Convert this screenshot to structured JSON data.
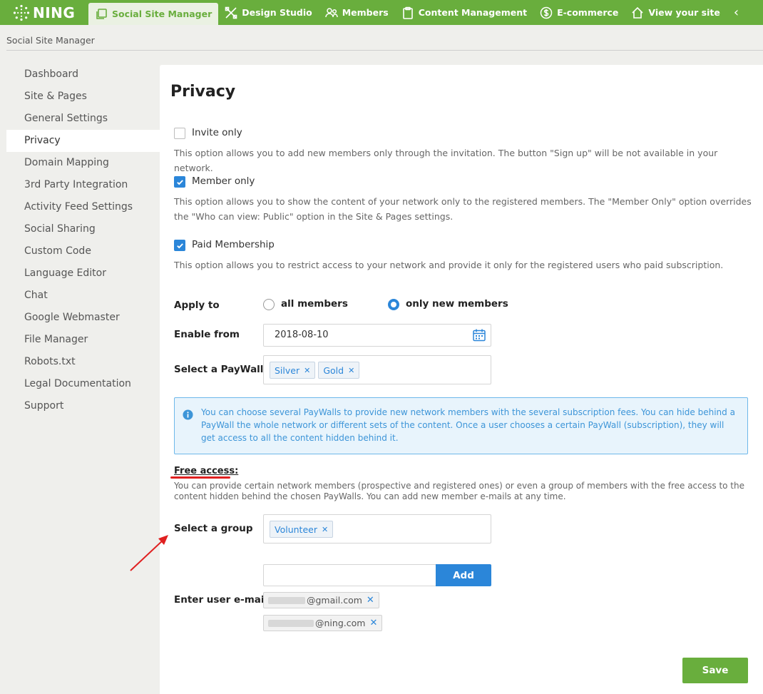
{
  "app": {
    "logo_text": "NING"
  },
  "topnav": {
    "tabs": [
      {
        "label": "Social Site Manager",
        "icon": "pages-icon"
      },
      {
        "label": "Design Studio",
        "icon": "design-tools-icon"
      },
      {
        "label": "Members",
        "icon": "members-icon"
      },
      {
        "label": "Content Management",
        "icon": "clipboard-icon"
      },
      {
        "label": "E-commerce",
        "icon": "dollar-icon"
      },
      {
        "label": "View your site",
        "icon": "home-icon"
      }
    ],
    "collapse_glyph": "‹"
  },
  "breadcrumb": "Social Site Manager",
  "sidebar": {
    "items": [
      {
        "label": "Dashboard"
      },
      {
        "label": "Site & Pages"
      },
      {
        "label": "General Settings"
      },
      {
        "label": "Privacy"
      },
      {
        "label": "Domain Mapping"
      },
      {
        "label": "3rd Party Integration"
      },
      {
        "label": "Activity Feed Settings"
      },
      {
        "label": "Social Sharing"
      },
      {
        "label": "Custom Code"
      },
      {
        "label": "Language Editor"
      },
      {
        "label": "Chat"
      },
      {
        "label": "Google Webmaster"
      },
      {
        "label": "File Manager"
      },
      {
        "label": "Robots.txt"
      },
      {
        "label": "Legal Documentation"
      },
      {
        "label": "Support"
      }
    ],
    "active_index": 3
  },
  "page": {
    "title": "Privacy",
    "options": [
      {
        "label": "Invite only",
        "checked": false,
        "description": "This option allows you to add new members only through the invitation. The button \"Sign up\" will be not available in your network."
      },
      {
        "label": "Member only",
        "checked": true,
        "description": "This option allows you to show the content of your network only to the registered members. The \"Member Only\" option overrides the \"Who can view: Public\" option in the Site & Pages settings."
      },
      {
        "label": "Paid Membership",
        "checked": true,
        "description": "This option allows you to restrict access to your network and provide it only for the registered users who paid subscription."
      }
    ],
    "apply_to": {
      "label": "Apply to",
      "options": [
        "all members",
        "only new members"
      ],
      "selected": "only new members"
    },
    "enable_from": {
      "label": "Enable from",
      "value": "2018-08-10"
    },
    "paywall": {
      "label": "Select a PayWall",
      "tags": [
        "Silver",
        "Gold"
      ]
    },
    "info_text": "You can choose several PayWalls to provide new network members with the several subscription fees. You can hide behind a PayWall the whole network or different sets of the content. Once a user chooses a certain PayWall (subscription), they will get access to all the content hidden behind it.",
    "free_access": {
      "title": "Free access:",
      "description": "You can provide certain network members (prospective and registered ones) or even a group of members with the free access to the content hidden behind the chosen PayWalls. You can add new member e-mails at any time."
    },
    "group": {
      "label": "Select a group",
      "tags": [
        "Volunteer"
      ]
    },
    "email": {
      "label": "Enter user e-mail",
      "input_value": "",
      "add_label": "Add",
      "entries": [
        "@gmail.com",
        "@ning.com"
      ]
    },
    "save_label": "Save"
  },
  "colors": {
    "brand_green": "#69ae3d",
    "accent_blue": "#2b86d9",
    "annotation_red": "#e02020"
  }
}
